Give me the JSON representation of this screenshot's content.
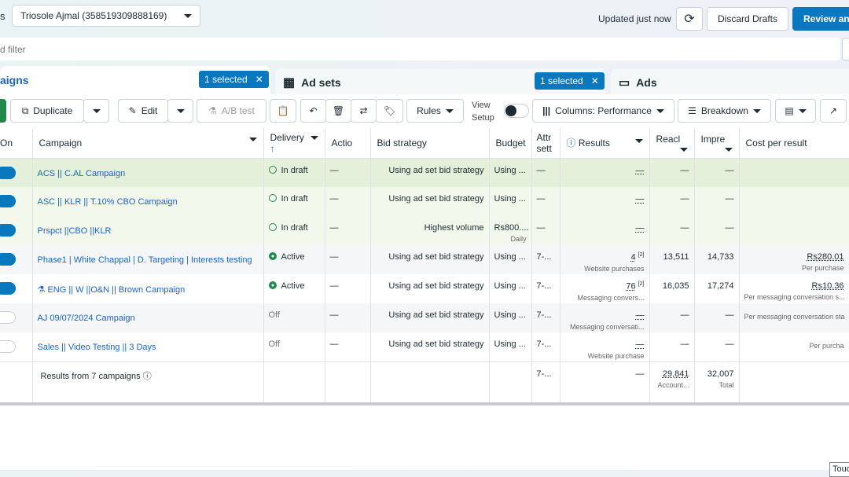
{
  "header": {
    "account_label_fragment": "s",
    "account": "Triosole Ajmal (358519309888169)",
    "updated": "Updated just now",
    "discard": "Discard Drafts",
    "review": "Review and"
  },
  "filter": {
    "placeholder": "d filter"
  },
  "tabs": [
    {
      "label": "aigns",
      "selected": "1 selected"
    },
    {
      "label": "Ad sets",
      "selected": "1 selected"
    },
    {
      "label": "Ads"
    }
  ],
  "toolbar": {
    "duplicate": "Duplicate",
    "edit": "Edit",
    "ab_test": "A/B test",
    "rules": "Rules",
    "view_setup_1": "View",
    "view_setup_2": "Setup",
    "columns": "Columns: Performance",
    "breakdown": "Breakdown"
  },
  "columns": [
    "On",
    "Campaign",
    "Delivery",
    "Actio",
    "Bid strategy",
    "Budget",
    "Attr sett",
    "Results",
    "Reacl",
    "Impre",
    "Cost per result"
  ],
  "rows": [
    {
      "on": true,
      "name": "ACS || C.AL Campaign",
      "delivery": "In draft",
      "status": "draft",
      "action": "—",
      "bid": "Using ad set bid strategy",
      "budget": "Using ...",
      "budget_sub": "",
      "attr": "—",
      "results": "—",
      "results_sub": "",
      "reach": "—",
      "impr": "—",
      "cost": "",
      "cost_sub": ""
    },
    {
      "on": true,
      "name": "ASC || KLR || T.10% CBO Campaign",
      "delivery": "In draft",
      "status": "draft",
      "action": "—",
      "bid": "Using ad set bid strategy",
      "budget": "Using ...",
      "budget_sub": "",
      "attr": "—",
      "results": "—",
      "results_sub": "",
      "reach": "—",
      "impr": "—",
      "cost": "",
      "cost_sub": ""
    },
    {
      "on": true,
      "name": "Prspct ||CBO ||KLR",
      "delivery": "In draft",
      "status": "draft",
      "action": "—",
      "bid": "Highest volume",
      "budget": "Rs800....",
      "budget_sub": "Daily",
      "attr": "—",
      "results": "—",
      "results_sub": "",
      "reach": "—",
      "impr": "—",
      "cost": "",
      "cost_sub": ""
    },
    {
      "on": true,
      "name": "Phase1 | White Chappal | D. Targeting | Interests testing",
      "delivery": "Active",
      "status": "active",
      "action": "—",
      "bid": "Using ad set bid strategy",
      "budget": "Using ...",
      "budget_sub": "",
      "attr": "7-...",
      "results": "4",
      "results_sup": "[2]",
      "results_sub": "Website purchases",
      "reach": "13,511",
      "impr": "14,733",
      "cost": "Rs280.01",
      "cost_sub": "Per purchase"
    },
    {
      "on": true,
      "name": "ENG || W ||O&N || Brown Campaign",
      "delivery": "Active",
      "status": "active",
      "action": "—",
      "bid": "Using ad set bid strategy",
      "budget": "Using ...",
      "budget_sub": "",
      "attr": "7-...",
      "results": "76",
      "results_sup": "[2]",
      "results_sub": "Messaging convers...",
      "reach": "16,035",
      "impr": "17,274",
      "cost": "Rs10.36",
      "cost_sub": "Per messaging conversation s..."
    },
    {
      "on": false,
      "name": "AJ 09/07/2024 Campaign",
      "delivery": "Off",
      "status": "off",
      "action": "—",
      "bid": "Using ad set bid strategy",
      "budget": "Using ...",
      "budget_sub": "",
      "attr": "7-...",
      "results": "—",
      "results_sub": "Messaging conversati...",
      "reach": "—",
      "impr": "—",
      "cost": "",
      "cost_sub": "Per messaging conversation sta"
    },
    {
      "on": false,
      "name": "Sales || Video Testing || 3 Days",
      "delivery": "Off",
      "status": "off",
      "action": "—",
      "bid": "Using ad set bid strategy",
      "budget": "Using ...",
      "budget_sub": "",
      "attr": "7-...",
      "results": "—",
      "results_sub": "Website purchase",
      "reach": "—",
      "impr": "—",
      "cost": "",
      "cost_sub": "Per purcha"
    }
  ],
  "footer": {
    "label": "Results from 7 campaigns",
    "attr": "7-...",
    "results": "—",
    "reach": "29,841",
    "reach_sub": "Account...",
    "impr": "32,007",
    "impr_sub": "Total"
  },
  "corner": "Touc",
  "colors": {
    "primary": "#0a78be",
    "active": "#1f8a4c",
    "link": "#1a64c0"
  }
}
